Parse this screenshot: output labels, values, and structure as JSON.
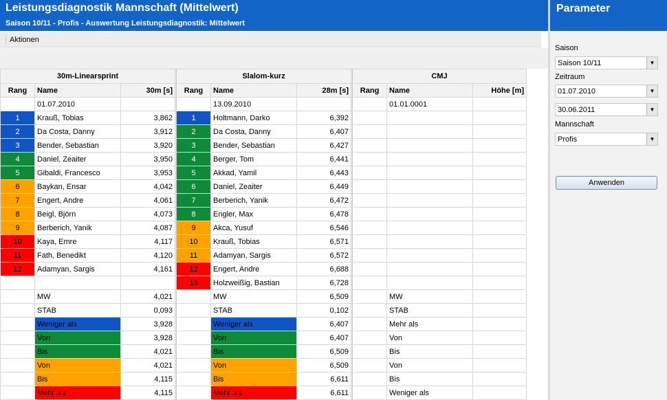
{
  "header": {
    "title": "Leistungsdiagnostik Mannschaft (Mittelwert)",
    "subtitle": "Saison 10/11 - Profis - Auswertung Leistungsdiagnostik: Mittelwert"
  },
  "toolbar": {
    "actions_label": "Aktionen"
  },
  "groups": [
    "30m-Linearsprint",
    "Slalom-kurz",
    "CMJ"
  ],
  "columns": [
    [
      "Rang",
      "Name",
      "30m [s]"
    ],
    [
      "Rang",
      "Name",
      "28m [s]"
    ],
    [
      "Rang",
      "Name",
      "Höhe [m]"
    ]
  ],
  "dates": [
    "01.07.2010",
    "13.09.2010",
    "01.01.0001"
  ],
  "sprint": [
    {
      "rank": "1",
      "name": "Krauß, Tobias",
      "value": "3,862",
      "color": "blue"
    },
    {
      "rank": "2",
      "name": "Da Costa, Danny",
      "value": "3,912",
      "color": "blue"
    },
    {
      "rank": "3",
      "name": "Bender, Sebastian",
      "value": "3,920",
      "color": "blue"
    },
    {
      "rank": "4",
      "name": "Daniel, Zeaiter",
      "value": "3,950",
      "color": "green"
    },
    {
      "rank": "5",
      "name": "Gibaldi, Francesco",
      "value": "3,953",
      "color": "green"
    },
    {
      "rank": "6",
      "name": "Baykan, Ensar",
      "value": "4,042",
      "color": "orange"
    },
    {
      "rank": "7",
      "name": "Engert, Andre",
      "value": "4,061",
      "color": "orange"
    },
    {
      "rank": "8",
      "name": "Beigl, Björn",
      "value": "4,073",
      "color": "orange"
    },
    {
      "rank": "9",
      "name": "Berberich, Yanik",
      "value": "4,087",
      "color": "orange"
    },
    {
      "rank": "10",
      "name": "Kaya, Emre",
      "value": "4,117",
      "color": "red"
    },
    {
      "rank": "11",
      "name": "Fath, Benedikt",
      "value": "4,120",
      "color": "red"
    },
    {
      "rank": "12",
      "name": "Adamyan, Sargis",
      "value": "4,161",
      "color": "red"
    }
  ],
  "slalom": [
    {
      "rank": "1",
      "name": "Holtmann, Darko",
      "value": "6,392",
      "color": "blue"
    },
    {
      "rank": "2",
      "name": "Da Costa, Danny",
      "value": "6,407",
      "color": "green"
    },
    {
      "rank": "3",
      "name": "Bender, Sebastian",
      "value": "6,427",
      "color": "green"
    },
    {
      "rank": "4",
      "name": "Berger, Tom",
      "value": "6,441",
      "color": "green"
    },
    {
      "rank": "5",
      "name": "Akkad, Yamil",
      "value": "6,443",
      "color": "green"
    },
    {
      "rank": "6",
      "name": "Daniel, Zeaiter",
      "value": "6,449",
      "color": "green"
    },
    {
      "rank": "7",
      "name": "Berberich, Yanik",
      "value": "6,472",
      "color": "green"
    },
    {
      "rank": "8",
      "name": "Engler, Max",
      "value": "6,478",
      "color": "green"
    },
    {
      "rank": "9",
      "name": "Akca, Yusuf",
      "value": "6,546",
      "color": "orange"
    },
    {
      "rank": "10",
      "name": "Krauß, Tobias",
      "value": "6,571",
      "color": "orange"
    },
    {
      "rank": "11",
      "name": "Adamyan, Sargis",
      "value": "6,572",
      "color": "orange"
    },
    {
      "rank": "12",
      "name": "Engert, Andre",
      "value": "6,688",
      "color": "red"
    },
    {
      "rank": "13",
      "name": "Holzweißig, Bastian",
      "value": "6,728",
      "color": "red"
    }
  ],
  "stats": [
    {
      "label": "MW",
      "color": "",
      "v1": "4,021",
      "v2": "6,509",
      "l3": "MW"
    },
    {
      "label": "STAB",
      "color": "",
      "v1": "0,093",
      "v2": "0,102",
      "l3": "STAB"
    },
    {
      "label": "Weniger als",
      "color": "blue",
      "v1": "3,928",
      "v2": "6,407",
      "l3": "Mehr als"
    },
    {
      "label": "Von",
      "color": "green",
      "v1": "3,928",
      "v2": "6,407",
      "l3": "Von"
    },
    {
      "label": "Bis",
      "color": "green",
      "v1": "4,021",
      "v2": "6,509",
      "l3": "Bis"
    },
    {
      "label": "Von",
      "color": "orange",
      "v1": "4,021",
      "v2": "6,509",
      "l3": "Von"
    },
    {
      "label": "Bis",
      "color": "orange",
      "v1": "4,115",
      "v2": "6,611",
      "l3": "Bis"
    },
    {
      "label": "Mehr als",
      "color": "red",
      "v1": "4,115",
      "v2": "6,611",
      "l3": "Weniger als"
    }
  ],
  "colors": {
    "blue": "#1155c4",
    "green": "#0f8a3a",
    "orange": "#ffa200",
    "red": "#ff0000",
    "header": "#1265c6"
  },
  "sidebar": {
    "title": "Parameter",
    "saison_label": "Saison",
    "saison_value": "Saison 10/11",
    "zeitraum_label": "Zeitraum",
    "date_from": "01.07.2010",
    "date_to": "30.06.2011",
    "mannschaft_label": "Mannschaft",
    "mannschaft_value": "Profis",
    "apply_label": "Anwenden"
  }
}
